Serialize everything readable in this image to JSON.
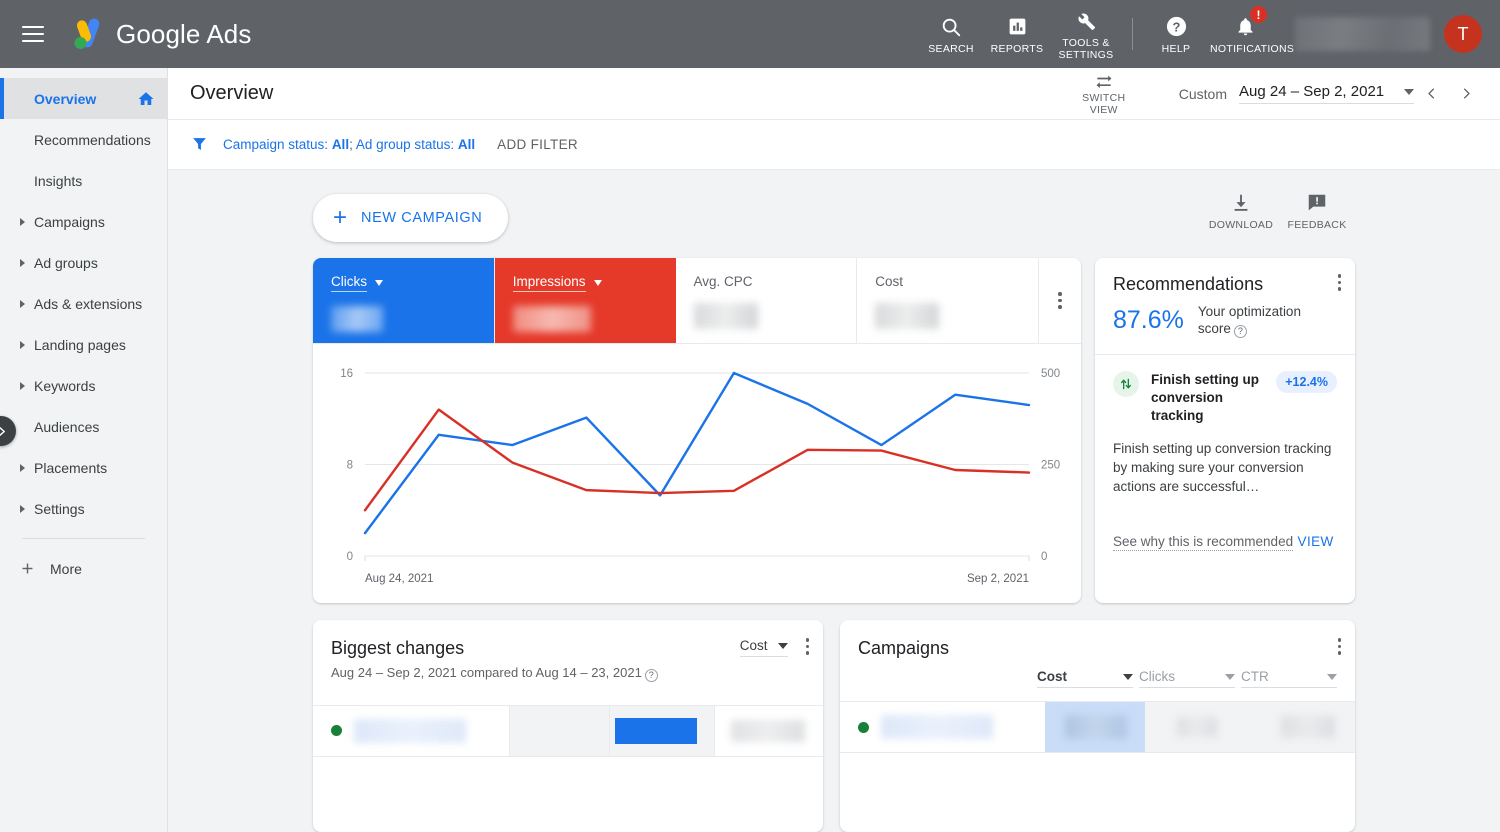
{
  "app": {
    "brand_google": "Google",
    "brand_ads": "Ads",
    "avatar_initial": "T"
  },
  "topbar": {
    "items": [
      {
        "label": "SEARCH",
        "icon": "search-icon"
      },
      {
        "label": "REPORTS",
        "icon": "reports-icon"
      },
      {
        "label": "TOOLS & SETTINGS",
        "icon": "tools-icon"
      },
      {
        "label": "HELP",
        "icon": "help-icon"
      },
      {
        "label": "NOTIFICATIONS",
        "icon": "bell-icon"
      }
    ],
    "search_label": "SEARCH",
    "reports_label": "REPORTS",
    "tools_label": "TOOLS & SETTINGS",
    "help_label": "HELP",
    "notifications_label": "NOTIFICATIONS",
    "notification_badge": "!"
  },
  "sidebar": {
    "items": [
      {
        "label": "Overview",
        "expandable": false,
        "active": true
      },
      {
        "label": "Recommendations",
        "expandable": false,
        "active": false
      },
      {
        "label": "Insights",
        "expandable": false,
        "active": false
      },
      {
        "label": "Campaigns",
        "expandable": true,
        "active": false
      },
      {
        "label": "Ad groups",
        "expandable": true,
        "active": false
      },
      {
        "label": "Ads & extensions",
        "expandable": true,
        "active": false
      },
      {
        "label": "Landing pages",
        "expandable": true,
        "active": false
      },
      {
        "label": "Keywords",
        "expandable": true,
        "active": false
      },
      {
        "label": "Audiences",
        "expandable": false,
        "active": false
      },
      {
        "label": "Placements",
        "expandable": true,
        "active": false
      },
      {
        "label": "Settings",
        "expandable": true,
        "active": false
      }
    ],
    "more_label": "More"
  },
  "header": {
    "page_title": "Overview",
    "switch_view_label": "SWITCH VIEW",
    "custom_label": "Custom",
    "date_range": "Aug 24 – Sep 2, 2021"
  },
  "filter": {
    "campaign_status_prefix": "Campaign status: ",
    "campaign_status_value": "All",
    "separator": "; ",
    "ad_group_status_prefix": "Ad group status: ",
    "ad_group_status_value": "All",
    "add_filter_label": "ADD FILTER"
  },
  "actions": {
    "new_campaign_label": "NEW CAMPAIGN",
    "new_campaign_plus": "+",
    "download_label": "DOWNLOAD",
    "feedback_label": "FEEDBACK"
  },
  "metrics": {
    "cards": [
      {
        "label": "Clicks",
        "has_dropdown": true,
        "state": "clicks",
        "value_hidden": true
      },
      {
        "label": "Impressions",
        "has_dropdown": true,
        "state": "impressions",
        "value_hidden": true
      },
      {
        "label": "Avg. CPC",
        "has_dropdown": false,
        "state": "plain",
        "value_hidden": true
      },
      {
        "label": "Cost",
        "has_dropdown": false,
        "state": "plain",
        "value_hidden": true
      }
    ],
    "clicks_label": "Clicks",
    "impressions_label": "Impressions",
    "avg_cpc_label": "Avg. CPC",
    "cost_label": "Cost"
  },
  "chart_data": {
    "type": "line",
    "title": "",
    "x": [
      "Aug 24, 2021",
      "Aug 25, 2021",
      "Aug 26, 2021",
      "Aug 27, 2021",
      "Aug 28, 2021",
      "Aug 29, 2021",
      "Aug 30, 2021",
      "Aug 31, 2021",
      "Sep 1, 2021",
      "Sep 2, 2021"
    ],
    "xtick_labels": [
      "Aug 24, 2021",
      "Sep 2, 2021"
    ],
    "xlabel": "",
    "grid": true,
    "legend_position": "none",
    "series": [
      {
        "name": "Clicks",
        "color": "#1a73e8",
        "axis": "left",
        "values": [
          2.0,
          10.6,
          9.7,
          12.1,
          5.3,
          16.0,
          13.3,
          9.7,
          14.1,
          13.2
        ]
      },
      {
        "name": "Impressions",
        "color": "#d93025",
        "axis": "right",
        "values": [
          125,
          400,
          255,
          180,
          172,
          178,
          290,
          288,
          235,
          228
        ]
      }
    ],
    "left_axis": {
      "label": "Clicks",
      "ticks": [
        0,
        8,
        16
      ],
      "ylim": [
        0,
        16
      ]
    },
    "right_axis": {
      "label": "Impressions",
      "ticks": [
        0,
        250,
        500
      ],
      "ylim": [
        0,
        500
      ]
    }
  },
  "recommendations": {
    "title": "Recommendations",
    "score": "87.6%",
    "score_label": "Your optimization score",
    "item_title": "Finish setting up conversion tracking",
    "item_badge": "+12.4%",
    "item_desc": "Finish setting up conversion tracking by making sure your conversion actions are successful…",
    "why_label": "See why this is recommended",
    "view_label": "VIEW"
  },
  "biggest_changes": {
    "title": "Biggest changes",
    "subtitle": "Aug 24 – Sep 2, 2021 compared to Aug 14 – 23, 2021",
    "metric_select": "Cost"
  },
  "campaigns": {
    "title": "Campaigns",
    "columns": [
      "Cost",
      "Clicks",
      "CTR"
    ],
    "col_cost": "Cost",
    "col_clicks": "Clicks",
    "col_ctr": "CTR"
  },
  "colors": {
    "brand_blue": "#1a73e8",
    "brand_red": "#e5392a",
    "chart_red": "#d93025",
    "topbar_gray": "#5f6368",
    "status_green": "#188038",
    "avatar_red": "#c5331f"
  }
}
